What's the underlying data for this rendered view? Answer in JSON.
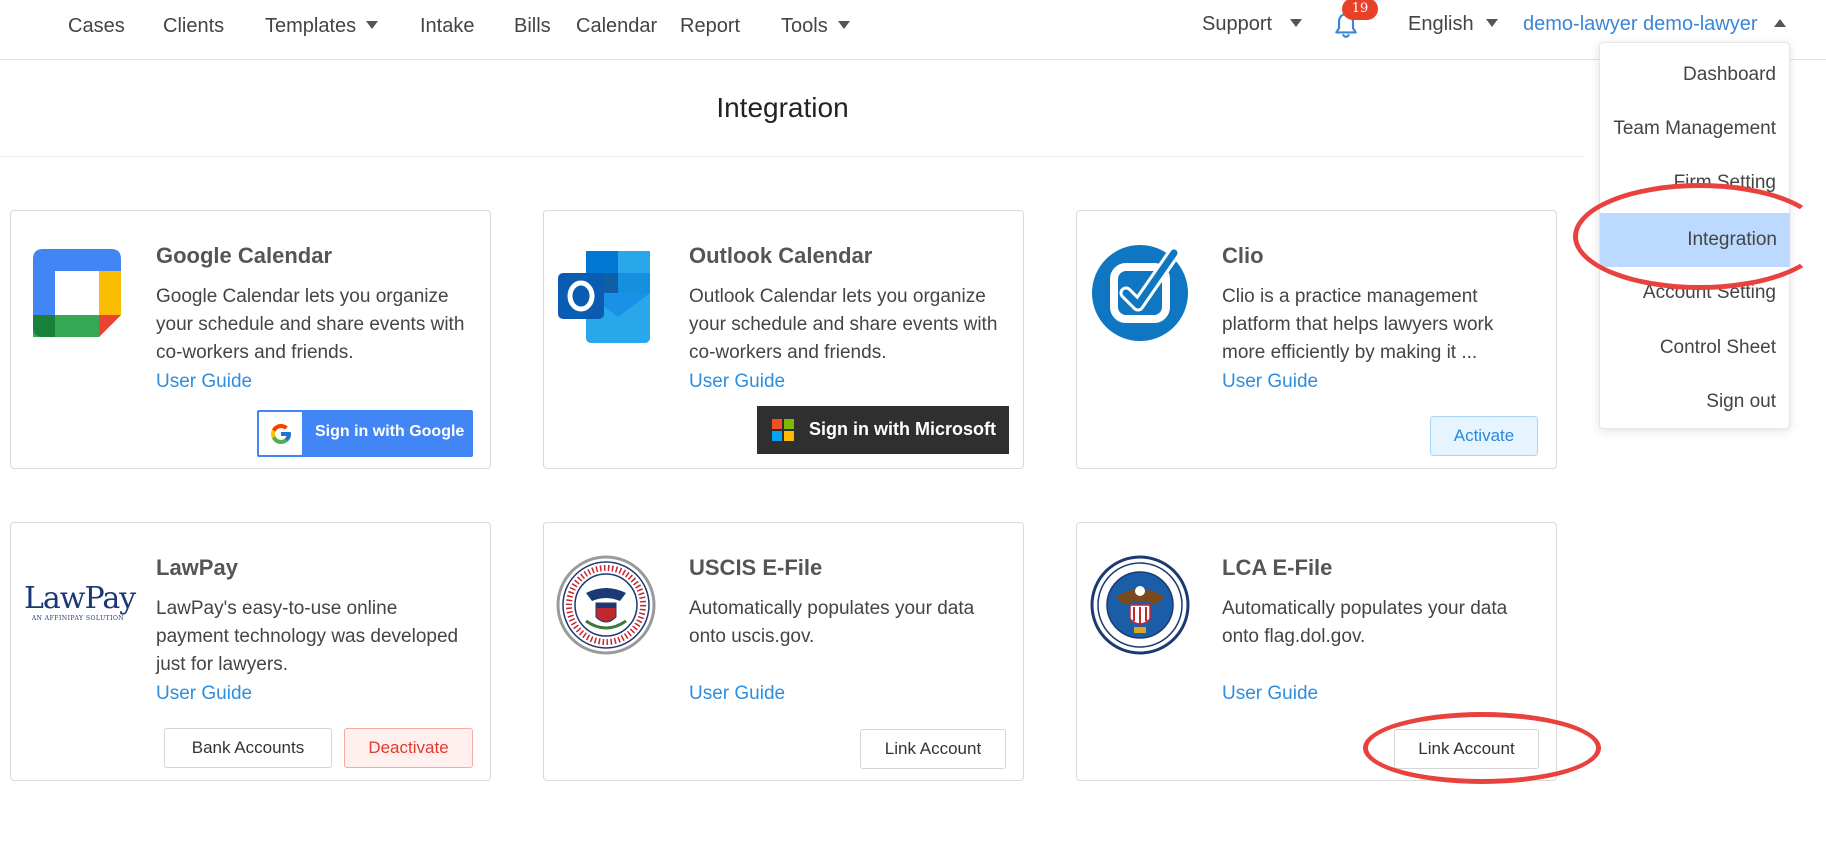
{
  "nav": {
    "items": [
      {
        "label": "Cases",
        "has_caret": false
      },
      {
        "label": "Clients",
        "has_caret": false
      },
      {
        "label": "Templates",
        "has_caret": true
      },
      {
        "label": "Intake",
        "has_caret": false
      },
      {
        "label": "Bills",
        "has_caret": false
      },
      {
        "label": "Calendar",
        "has_caret": false
      },
      {
        "label": "Report",
        "has_caret": false
      },
      {
        "label": "Tools",
        "has_caret": true
      }
    ],
    "support_label": "Support",
    "notification_count": "19",
    "language_label": "English",
    "user_label": "demo-lawyer demo-lawyer"
  },
  "page": {
    "title": "Integration"
  },
  "cards": [
    {
      "name": "Google Calendar",
      "description": "Google Calendar lets you organize your schedule and share events with co-workers and friends.",
      "guide_label": "User Guide",
      "action_label": "Sign in with Google"
    },
    {
      "name": "Outlook Calendar",
      "description": "Outlook Calendar lets you organize your schedule and share events with co-workers and friends.",
      "guide_label": "User Guide",
      "action_label": "Sign in with Microsoft"
    },
    {
      "name": "Clio",
      "description": "Clio is a practice management platform that helps lawyers work more efficiently by making it ...",
      "guide_label": "User Guide",
      "action_label": "Activate"
    },
    {
      "name": "LawPay",
      "description": "LawPay's easy-to-use online payment technology was developed just for lawyers.",
      "guide_label": "User Guide",
      "secondary_label": "Bank Accounts",
      "action_label": "Deactivate",
      "logo_text": "LawPay",
      "logo_subtext": "AN AFFINIPAY SOLUTION"
    },
    {
      "name": "USCIS E-File",
      "description": "Automatically populates your data onto uscis.gov.",
      "guide_label": "User Guide",
      "action_label": "Link Account"
    },
    {
      "name": "LCA E-File",
      "description": "Automatically populates your data onto flag.dol.gov.",
      "guide_label": "User Guide",
      "action_label": "Link Account"
    }
  ],
  "dropdown": {
    "items": [
      {
        "label": "Dashboard"
      },
      {
        "label": "Team Management"
      },
      {
        "label": "Firm Setting"
      },
      {
        "label": "Integration",
        "active": true
      },
      {
        "label": "Account Setting"
      },
      {
        "label": "Control Sheet"
      },
      {
        "label": "Sign out"
      }
    ]
  },
  "colors": {
    "link": "#2d8ee0",
    "active_menu": "#bcd9ff",
    "badge": "#e8412a",
    "annotation": "#e8423e",
    "google_blue": "#4285f4",
    "clio_blue": "#0f77c2"
  },
  "icons": {
    "notification": "bell-icon",
    "google_calendar": "google-calendar-logo",
    "outlook": "outlook-logo",
    "clio": "clio-check-logo",
    "uscis": "dhs-seal",
    "lca": "dol-seal"
  }
}
